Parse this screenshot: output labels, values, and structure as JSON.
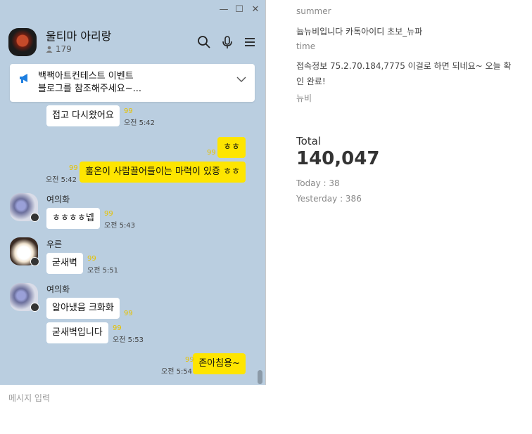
{
  "window": {
    "minimize": "—",
    "maximize": "☐",
    "close": "✕"
  },
  "room": {
    "title": "울티마 아리랑",
    "members": "179"
  },
  "notice": {
    "text": "백팩아트컨테스트 이벤트\n블로그를 참조해주세요~..."
  },
  "messages": {
    "m1": {
      "text": "접고 다시왔어요",
      "unread": "99",
      "time": "오전 5:42"
    },
    "m2": {
      "text": "ㅎㅎ",
      "unread": "99"
    },
    "m3": {
      "text": "훌온이 사람끌어들이는 마력이 있죵 ㅎㅎ",
      "unread": "99",
      "time": "오전 5:42"
    },
    "m4": {
      "sender": "여의화",
      "text": "ㅎㅎㅎㅎ넵",
      "unread": "99",
      "time": "오전 5:43"
    },
    "m5": {
      "sender": "우른",
      "text": "굳새벽",
      "unread": "99",
      "time": "오전 5:51"
    },
    "m6": {
      "sender": "여의화",
      "text": "알아냈음 크화화",
      "unread": "99"
    },
    "m7": {
      "text": "굳새벽입니다",
      "unread": "99",
      "time": "오전 5:53"
    },
    "m8": {
      "text": "존아침용~",
      "unread": "99",
      "time": "오전 5:54"
    }
  },
  "input": {
    "placeholder": "메시지 입력"
  },
  "info": {
    "summer_label": "summer",
    "summer_value": "늅뉴비입니다 카톡아이디 초보_뉴파",
    "time_label": "time",
    "time_value": "접속정보 75.2.70.184,7775 이걸로 하면 되네요~ 오늘 확인 완료!",
    "author": "뉴비",
    "total_label": "Total",
    "total_value": "140,047",
    "today": "Today : 38",
    "yesterday": "Yesterday : 386"
  }
}
